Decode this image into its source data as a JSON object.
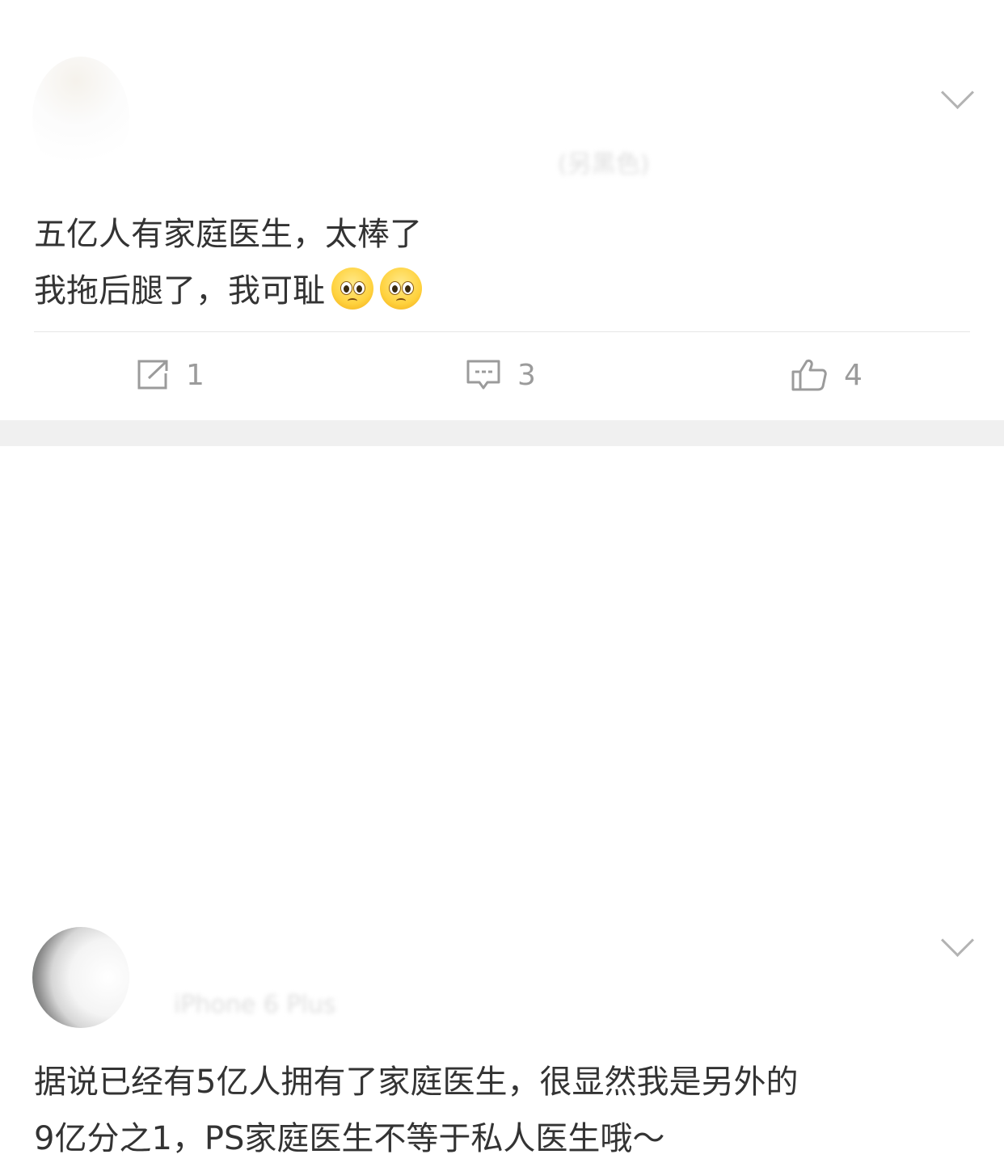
{
  "posts": [
    {
      "user_name": "",
      "meta": "(另黑色)",
      "content_lines": [
        "五亿人有家庭医生，太棒了",
        "我拖后腿了，我可耻"
      ],
      "emojis": [
        "pleading-face",
        "pleading-face"
      ],
      "actions": {
        "repost": {
          "icon": "repost-icon",
          "count": "1"
        },
        "comment": {
          "icon": "comment-icon",
          "count": "3"
        },
        "like": {
          "icon": "thumbs-up-icon",
          "count": "4"
        }
      }
    },
    {
      "user_name": "",
      "meta_blurred": "",
      "meta_source": "iPhone 6 Plus",
      "content_lines": [
        "据说已经有5亿人拥有了家庭医生，很显然我是另外的",
        "9亿分之1，PS家庭医生不等于私人医生哦～"
      ]
    }
  ],
  "colors": {
    "text": "#333333",
    "icon": "#9b9b9b",
    "separator": "#f0f0f0",
    "divider": "#e6e6e6"
  }
}
